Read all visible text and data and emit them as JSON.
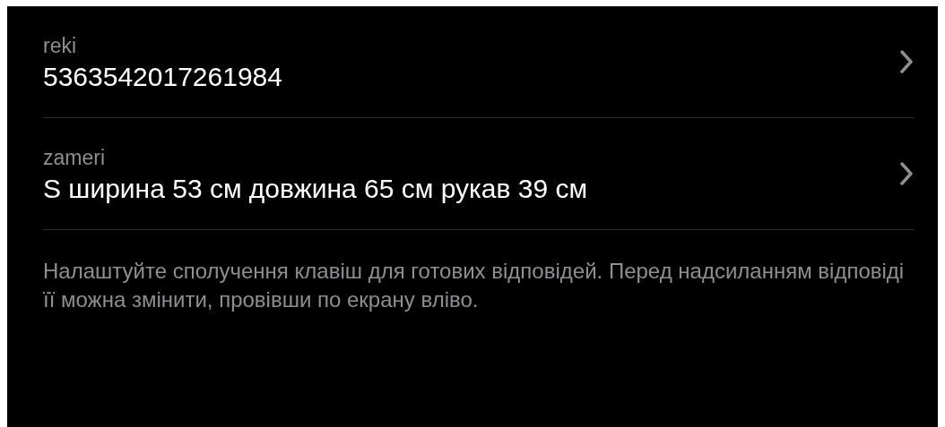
{
  "shortcuts": [
    {
      "phrase": "reki",
      "text": "5363542017261984"
    },
    {
      "phrase": "zameri",
      "text": "S ширина 53 см довжина 65 см рукав 39 см"
    }
  ],
  "footer": "Налаштуйте сполучення клавіш для готових відповідей. Перед надсиланням відповіді її можна змінити, провівши по екрану вліво."
}
